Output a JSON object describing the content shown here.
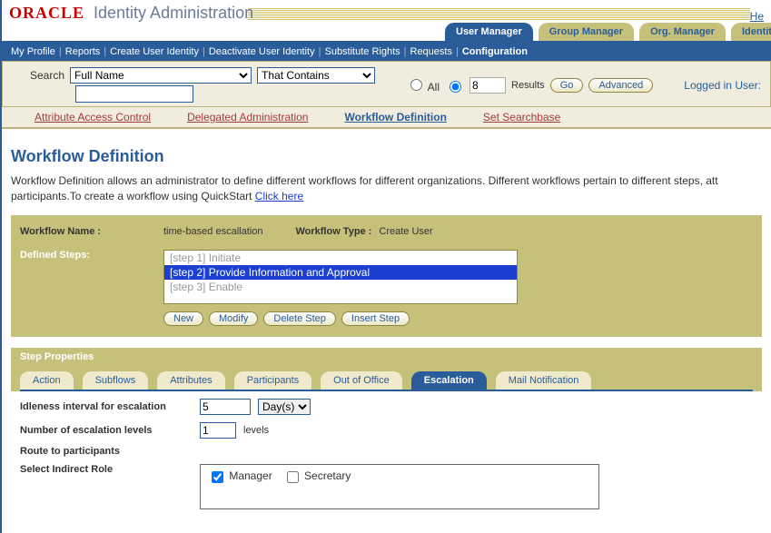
{
  "header": {
    "logo_brand": "ORACLE",
    "logo_product": "Identity Administration",
    "help": "He"
  },
  "module_tabs": [
    {
      "label": "User Manager",
      "active": true
    },
    {
      "label": "Group Manager",
      "active": false
    },
    {
      "label": "Org. Manager",
      "active": false
    },
    {
      "label": "Identity S",
      "active": false
    }
  ],
  "menubar": {
    "items": [
      "My Profile",
      "Reports",
      "Create User Identity",
      "Deactivate User Identity",
      "Substitute Rights",
      "Requests",
      "Configuration"
    ],
    "active": "Configuration"
  },
  "search": {
    "label": "Search",
    "field_options": [
      "Full Name"
    ],
    "field_value": "Full Name",
    "op_options": [
      "That Contains"
    ],
    "op_value": "That Contains",
    "text_value": "",
    "all_label": "All",
    "results_label": "Results",
    "results_value": "8",
    "go_label": "Go",
    "advanced_label": "Advanced",
    "logged_in": "Logged in User:"
  },
  "subnav": {
    "items": [
      "Attribute Access Control",
      "Delegated Administration",
      "Workflow Definition",
      "Set Searchbase"
    ],
    "active": "Workflow Definition"
  },
  "page": {
    "title": "Workflow Definition",
    "desc_prefix": "Workflow Definition allows an administrator to define different workflows for different organizations. Different workflows pertain to different steps, att",
    "desc_line2": "participants.To create a workflow using QuickStart ",
    "click_here": "Click here"
  },
  "workflow": {
    "name_label": "Workflow Name  :",
    "name_value": "time-based escallation",
    "type_label": "Workflow Type  :",
    "type_value": "Create User",
    "steps_label": "Defined Steps:",
    "steps": [
      {
        "text": "[step 1] Initiate",
        "selected": false
      },
      {
        "text": "[step 2] Provide Information and Approval",
        "selected": true
      },
      {
        "text": "[step 3] Enable",
        "selected": false
      }
    ],
    "buttons": {
      "new_": "New",
      "modify": "Modify",
      "delete_": "Delete Step",
      "insert": "Insert Step"
    }
  },
  "step_props": {
    "header": "Step Properties",
    "tabs": [
      "Action",
      "Subflows",
      "Attributes",
      "Participants",
      "Out of Office",
      "Escalation",
      "Mail Notification"
    ],
    "active_tab": "Escalation",
    "idle_label": "Idleness interval for escalation",
    "idle_value": "5",
    "idle_unit_options": [
      "Day(s)"
    ],
    "idle_unit": "Day(s)",
    "levels_label": "Number of escalation levels",
    "levels_value": "1",
    "levels_suffix": "levels",
    "route_label": "Route to participants",
    "role_label": "Select Indirect Role",
    "roles": [
      {
        "name": "Manager",
        "checked": true
      },
      {
        "name": "Secretary",
        "checked": false
      }
    ]
  }
}
